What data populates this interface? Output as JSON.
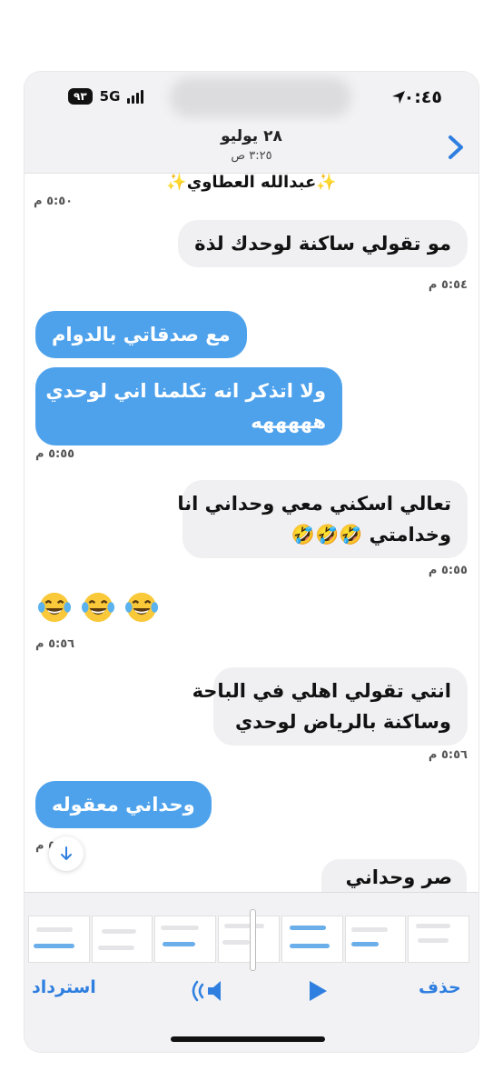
{
  "status": {
    "time": "٠:٤٥",
    "battery": "٩٣",
    "network": "5G"
  },
  "header": {
    "date": "٢٨ يوليو",
    "time": "٣:٢٥ ص",
    "contact": "✨عبدالله العطاوي✨"
  },
  "messages": [
    {
      "text": "مو تقولي ساكنة لوحدك لذة",
      "side": "received"
    },
    {
      "text": "مع صدقاتي بالدوام",
      "side": "sent"
    },
    {
      "text": "ولا اتذكر انه تكلمنا اني لوحدي",
      "text2": "هههههه",
      "side": "sent"
    },
    {
      "text": "تعالي اسكني معي وحداني انا",
      "text2": "وخدامتي 🤣🤣🤣",
      "side": "received"
    },
    {
      "text": "انتي تقولي اهلي في الباحة",
      "text2": "وساكنة بالرياض لوحدي",
      "side": "received"
    },
    {
      "text": "وحداني معقوله",
      "side": "sent"
    }
  ],
  "timestamps": {
    "cut": "٥:٥٠ م",
    "t1": "٥:٥٤ م",
    "t2": "٥:٥٥ م",
    "t3": "٥:٥٥ م",
    "t4": "٥:٥٦ م",
    "t5": "٥:٥٦ م",
    "t6": "٥:٥٦ م"
  },
  "partial": "صر وحداني",
  "toolbar": {
    "delete": "حذف",
    "restore": "استرداد"
  },
  "colors": {
    "sent_bubble": "#4ea2ec",
    "received_bubble": "#f0f0f2",
    "accent": "#2f7fe0"
  },
  "icons": [
    "back-chevron-icon",
    "location-arrow-icon",
    "signal-bars-icon",
    "laughing-tears-emoji-icon",
    "scroll-down-icon",
    "play-icon",
    "mute-icon"
  ]
}
